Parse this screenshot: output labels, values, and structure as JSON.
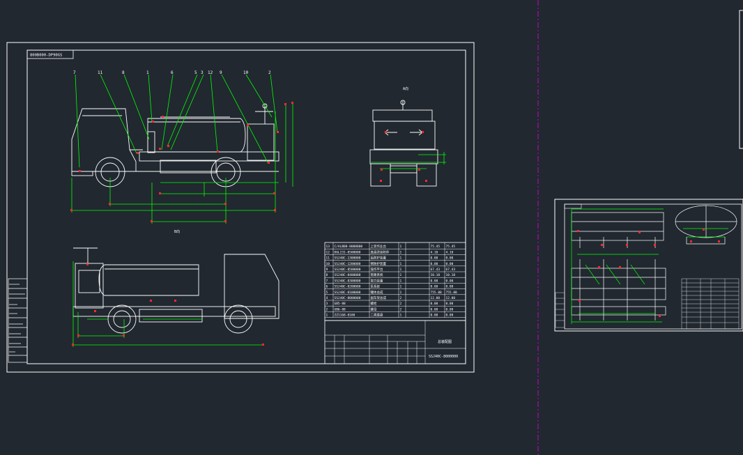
{
  "drawing": {
    "title_code": "800B000-DP90GS",
    "view_labels": [
      "A向",
      "B向"
    ],
    "leader_numbers": [
      "7",
      "11",
      "8",
      "1",
      "6",
      "5",
      "3",
      "12",
      "9",
      "10",
      "2"
    ],
    "title_block": {
      "drawing_name": "总装配图",
      "drawing_no": "SSJ40C-8000000"
    },
    "bom_rows": [
      [
        "13",
        "C/ALB08-8008000",
        "上装作业台",
        "1",
        "",
        "75.45",
        "75.45"
      ],
      [
        "12",
        "D6L231-8500000",
        "底盘改装附件",
        "1",
        "",
        "4.10",
        "4.10"
      ],
      [
        "11",
        "SSJ40C-1300000",
        "后防护装置",
        "1",
        "",
        "0.00",
        "0.00"
      ],
      [
        "10",
        "SSJ40C-1200000",
        "侧防护装置",
        "1",
        "",
        "0.00",
        "0.00"
      ],
      [
        "9",
        "SSJ40C-8500000",
        "操作平台",
        "1",
        "",
        "67.43",
        "67.43"
      ],
      [
        "8",
        "SSJ40C-8400000",
        "管路系统",
        "1",
        "",
        "10.10",
        "10.10"
      ],
      [
        "7",
        "SSJ40C-8300000",
        "取力装置",
        "1",
        "",
        "0.00",
        "0.00"
      ],
      [
        "6",
        "SSJ40C-8200000",
        "泵系统",
        "1",
        "",
        "0.00",
        "0.00"
      ],
      [
        "5",
        "SSJ40C-8100000",
        "罐体总成",
        "1",
        "",
        "755.00",
        "755.00"
      ],
      [
        "4",
        "SSJ40C-8000000",
        "副车架总成",
        "2",
        "",
        "12.00",
        "12.00"
      ],
      [
        "3",
        "GB5-88",
        "螺栓",
        "2",
        "",
        "0.00",
        "0.00"
      ],
      [
        "2",
        "GB6-88",
        "螺母",
        "2",
        "",
        "0.00",
        "0.00"
      ],
      [
        "1",
        "ZZ1168-8100",
        "二类底盘",
        "1",
        "",
        "0.00",
        "0.00"
      ]
    ]
  },
  "colors": {
    "background": "#212830",
    "line": "#ffffff",
    "dimension": "#00ff00",
    "marker": "#ff2a2a",
    "divider": "#c800c8"
  }
}
